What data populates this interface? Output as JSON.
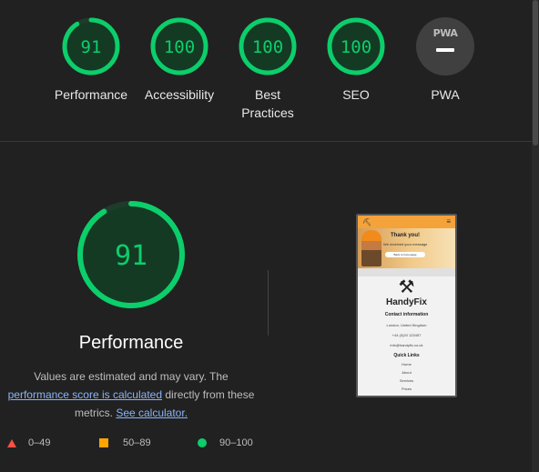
{
  "gauges": [
    {
      "score": "91",
      "value": 0.91,
      "label": "Performance"
    },
    {
      "score": "100",
      "value": 1.0,
      "label": "Accessibility"
    },
    {
      "score": "100",
      "value": 1.0,
      "label": "Best\nPractices"
    },
    {
      "score": "100",
      "value": 1.0,
      "label": "SEO"
    }
  ],
  "pwa": {
    "badge": "PWA",
    "label": "PWA"
  },
  "performance": {
    "score": "91",
    "value": 0.91,
    "title": "Performance",
    "desc_part1": "Values are estimated and may vary. The",
    "desc_link1": "performance score is calculated",
    "desc_part2": "directly from these metrics.",
    "desc_link2": "See calculator."
  },
  "legend": [
    {
      "range": "0–49",
      "shape": "triangle",
      "color": "#ff4e42"
    },
    {
      "range": "50–89",
      "shape": "square",
      "color": "#ffa400"
    },
    {
      "range": "90–100",
      "shape": "circle",
      "color": "#0cce6b"
    }
  ],
  "colors": {
    "pass": "#0cce6b",
    "background": "#212121",
    "link": "#8ab4f8"
  },
  "screenshot": {
    "hero_title": "Thank you!",
    "hero_sub": "We received your message",
    "hero_button": "Back to homepage",
    "brand": "HandyFix",
    "contact_heading": "Contact information",
    "contact_lines": [
      "London, United Kingdom",
      "+44 (0)20 123457",
      "info@handyfix.co.uk"
    ],
    "quick_links_heading": "Quick Links",
    "links": [
      "Home",
      "About",
      "Services",
      "Prices"
    ]
  }
}
